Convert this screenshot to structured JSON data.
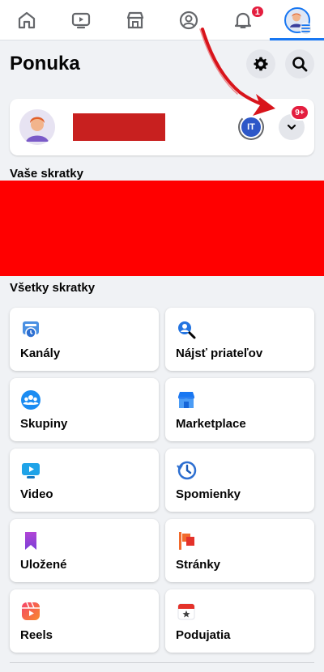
{
  "topnav": {
    "tabs": [
      {
        "icon": "home-icon"
      },
      {
        "icon": "video-icon"
      },
      {
        "icon": "marketplace-icon"
      },
      {
        "icon": "profile-icon"
      },
      {
        "icon": "bell-icon",
        "badge": "1"
      },
      {
        "icon": "avatar-menu-icon",
        "active": true
      }
    ]
  },
  "header": {
    "title": "Ponuka"
  },
  "profile": {
    "account_initials": "IT",
    "notification_badge": "9+"
  },
  "sections": {
    "your_shortcuts": "Vaše skratky",
    "all_shortcuts": "Všetky skratky"
  },
  "shortcuts": [
    {
      "label": "Kanály",
      "icon": "feeds-icon"
    },
    {
      "label": "Nájsť priateľov",
      "icon": "find-friends-icon"
    },
    {
      "label": "Skupiny",
      "icon": "groups-icon"
    },
    {
      "label": "Marketplace",
      "icon": "marketplace-icon"
    },
    {
      "label": "Video",
      "icon": "video-icon"
    },
    {
      "label": "Spomienky",
      "icon": "memories-icon"
    },
    {
      "label": "Uložené",
      "icon": "saved-icon"
    },
    {
      "label": "Stránky",
      "icon": "pages-icon"
    },
    {
      "label": "Reels",
      "icon": "reels-icon"
    },
    {
      "label": "Podujatia",
      "icon": "events-icon"
    }
  ],
  "colors": {
    "accent": "#1877f2",
    "badge": "#e41e3f",
    "annotation_arrow": "#d8141b",
    "redaction": "#ff0000"
  }
}
